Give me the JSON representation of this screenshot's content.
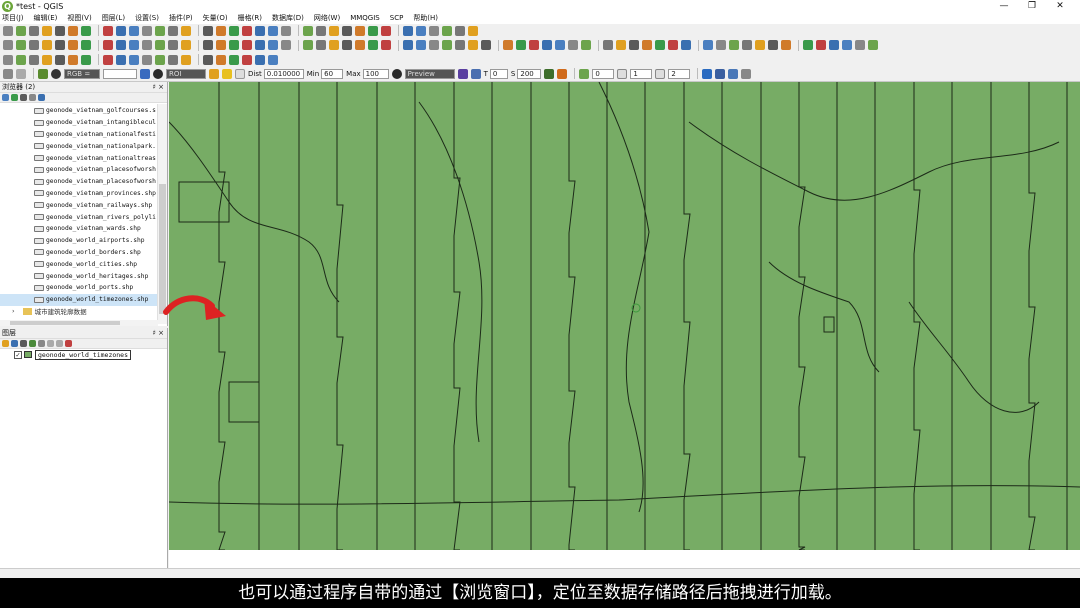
{
  "window": {
    "title": "*test - QGIS",
    "logo_letter": "Q",
    "minimize": "—",
    "restore": "❐",
    "close": "✕"
  },
  "menu": [
    "项目(J)",
    "编辑(E)",
    "视图(V)",
    "图层(L)",
    "设置(S)",
    "插件(P)",
    "矢量(O)",
    "栅格(R)",
    "数据库(D)",
    "网络(W)",
    "MMQGIS",
    "SCP",
    "帮助(H)"
  ],
  "toolbar4": {
    "rgb_label": "RGB =",
    "roi_label": "ROI",
    "dist_label": "Dist",
    "dist_value": "0.010000",
    "min_label": "Min",
    "min_value": "60",
    "max_label": "Max",
    "max_value": "100",
    "preview_label": "Preview",
    "t_value": "0",
    "s_value": "200",
    "v0": "0",
    "v1": "1",
    "v2": "2"
  },
  "browser": {
    "title": "浏览器 (2)",
    "close": "♯ ×",
    "items": [
      "geonode_vietnam_golfcourses.s",
      "geonode_vietnam_intangiblecul",
      "geonode_vietnam_nationalfesti",
      "geonode_vietnam_nationalpark.",
      "geonode_vietnam_nationaltreas",
      "geonode_vietnam_placesofworsh",
      "geonode_vietnam_placesofworsh",
      "geonode_vietnam_provinces.shp",
      "geonode_vietnam_railways.shp",
      "geonode_vietnam_rivers_polyli",
      "geonode_vietnam_wards.shp",
      "geonode_world_airports.shp",
      "geonode_world_borders.shp",
      "geonode_world_cities.shp",
      "geonode_world_heritages.shp",
      "geonode_world_ports.shp",
      "geonode_world_timezones.shp"
    ],
    "selected_index": 16,
    "folder": "城市建筑轮廓数据"
  },
  "layers": {
    "title": "图层",
    "close": "♯ ×",
    "rows": [
      {
        "name": "geonode_world_timezones",
        "checked": "✓"
      }
    ]
  },
  "map": {
    "fill": "#77ac65",
    "line": "#1c2a18"
  },
  "subtitle": "也可以通过程序自带的通过【浏览窗口】，定位至数据存储路径后拖拽进行加载。"
}
